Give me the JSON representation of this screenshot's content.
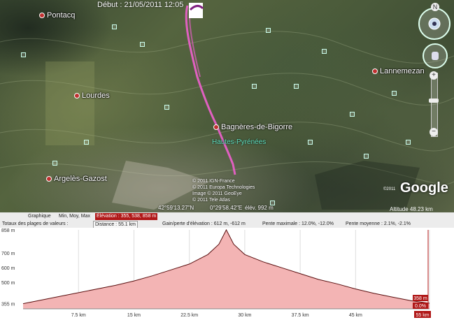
{
  "map": {
    "title": "Début : 21/05/2011 12:05",
    "places": [
      {
        "label": "Pontacq"
      },
      {
        "label": "Lourdes"
      },
      {
        "label": "Lannemezan"
      },
      {
        "label": "Bagnères-de-Bigorre"
      },
      {
        "label": "Argelès-Gazost"
      }
    ],
    "region": "Hautes-Pyrénées",
    "credits": [
      "© 2011 IGN-France",
      "© 2011 Europa Technologies",
      "Image © 2011 GeoEye",
      "© 2011 Tele Atlas"
    ],
    "lat": "42°59'13.27\"N",
    "lon": "0°29'58.42\"E",
    "elev": "élév. 992 m",
    "google": "Google",
    "altitude": "Altitude   48.23 km",
    "logo_year": "©2011",
    "compass_n": "N",
    "zoom_in": "+",
    "zoom_out": "−",
    "track_color": "#e060c0"
  },
  "profile_header": {
    "row1": {
      "graph_label": "Graphique",
      "stats": "Min, Moy, Max",
      "elevation_label": "Élévation :",
      "elevation_value": "355, 538, 858 m"
    },
    "row2": {
      "totals": "Totaux des plages de valeurs :",
      "distance": "Distance : 55.1 km",
      "gain": "Gain/perte d'élévation : 612 m, -612 m",
      "max_slope": "Pente maximale : 12.0%, -12.0%",
      "avg_slope": "Pente moyenne : 2.1%, -2.1%"
    }
  },
  "chart_data": {
    "type": "area",
    "x": [
      0,
      2.5,
      5,
      7.5,
      10,
      12.5,
      15,
      17.5,
      20,
      22.5,
      25,
      26.5,
      27.5,
      28.5,
      30,
      32.5,
      35,
      37.5,
      40,
      42.5,
      45,
      47.5,
      50,
      52.5,
      55
    ],
    "y": [
      355,
      380,
      405,
      430,
      455,
      480,
      510,
      545,
      585,
      625,
      690,
      760,
      858,
      760,
      690,
      640,
      600,
      560,
      520,
      490,
      455,
      425,
      400,
      375,
      358
    ],
    "xlim": [
      0,
      55
    ],
    "ylim": [
      320,
      858
    ],
    "xticks": [
      "7.5 km",
      "15 km",
      "22.5 km",
      "30 km",
      "37.5 km",
      "45 km",
      "55 km"
    ],
    "xtick_values": [
      7.5,
      15,
      22.5,
      30,
      37.5,
      45,
      55
    ],
    "yticks": [
      "858 m",
      "700 m",
      "600 m",
      "500 m",
      "355 m"
    ],
    "ytick_values": [
      858,
      700,
      600,
      500,
      355
    ],
    "end_value": "358 m",
    "end_slope": "0.0%",
    "fill_color": "#f3b4b4",
    "line_color": "#5a1010",
    "grid": true
  }
}
